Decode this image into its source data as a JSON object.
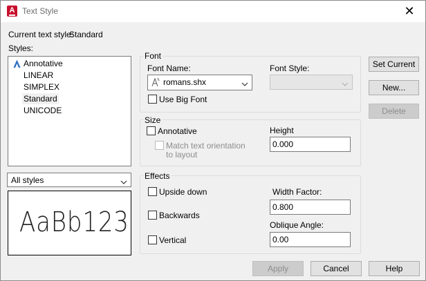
{
  "window": {
    "title": "Text Style",
    "app_icon_letter": "A",
    "close_glyph": "✕"
  },
  "current_style": {
    "label": "Current text style:",
    "value": "Standard"
  },
  "styles": {
    "label": "Styles:",
    "items": [
      {
        "label": "Annotative",
        "icon": "annotative-icon"
      },
      {
        "label": "LINEAR"
      },
      {
        "label": "SIMPLEX"
      },
      {
        "label": "Standard",
        "selected": true
      },
      {
        "label": "UNICODE"
      }
    ],
    "filter": {
      "value": "All styles"
    },
    "preview_text": "AaBb123"
  },
  "font": {
    "group_title": "Font",
    "font_name_label": "Font Name:",
    "font_name_value": "romans.shx",
    "font_style_label": "Font Style:",
    "font_style_value": "",
    "big_font_label": "Use Big Font",
    "big_font_checked": false
  },
  "size": {
    "group_title": "Size",
    "annotative_label": "Annotative",
    "annotative_checked": false,
    "match_label_line1": "Match text orientation",
    "match_label_line2": "to layout",
    "height_label": "Height",
    "height_value": "0.000"
  },
  "effects": {
    "group_title": "Effects",
    "upside_down_label": "Upside down",
    "backwards_label": "Backwards",
    "vertical_label": "Vertical",
    "width_factor_label": "Width Factor:",
    "width_factor_value": "0.800",
    "oblique_label": "Oblique Angle:",
    "oblique_value": "0.00"
  },
  "buttons": {
    "set_current": "Set Current",
    "new": "New...",
    "delete": "Delete",
    "apply": "Apply",
    "cancel": "Cancel",
    "help": "Help"
  }
}
